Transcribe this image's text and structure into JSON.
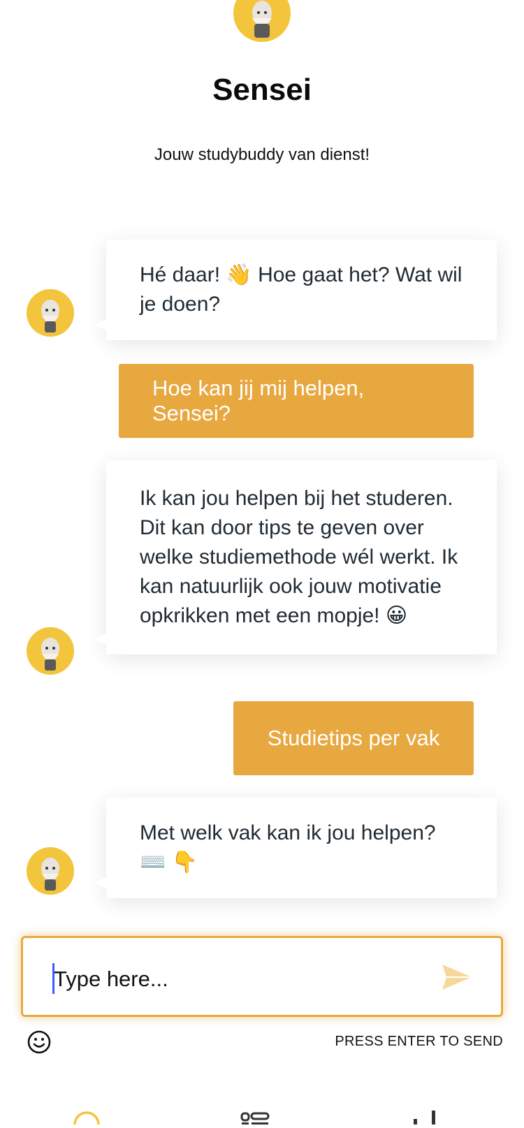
{
  "header": {
    "title": "Sensei",
    "subtitle": "Jouw studybuddy van dienst!"
  },
  "messages": [
    {
      "from": "bot",
      "text": "Hé daar! 👋 Hoe gaat het? Wat wil je doen?"
    },
    {
      "from": "user",
      "text": "Hoe kan jij mij helpen, Sensei?"
    },
    {
      "from": "bot",
      "text": "Ik kan jou helpen bij het studeren. Dit kan door tips te geven over welke studiemethode wél werkt. Ik kan natuurlijk ook jouw motivatie opkrikken met een mopje! 😀"
    },
    {
      "from": "user",
      "text": "Studietips per vak"
    },
    {
      "from": "bot",
      "text": "Met welk vak kan ik jou helpen? ⌨️ 👇"
    }
  ],
  "composer": {
    "placeholder": "Type here...",
    "hint": "PRESS ENTER TO SEND"
  },
  "colors": {
    "accent": "#e8a840",
    "avatar_bg": "#f3c53d",
    "caret": "#3a5bff"
  },
  "icons": {
    "send": "send-icon",
    "emoji": "smiley-icon",
    "nav": [
      "chat-icon",
      "list-icon",
      "stats-icon"
    ]
  }
}
